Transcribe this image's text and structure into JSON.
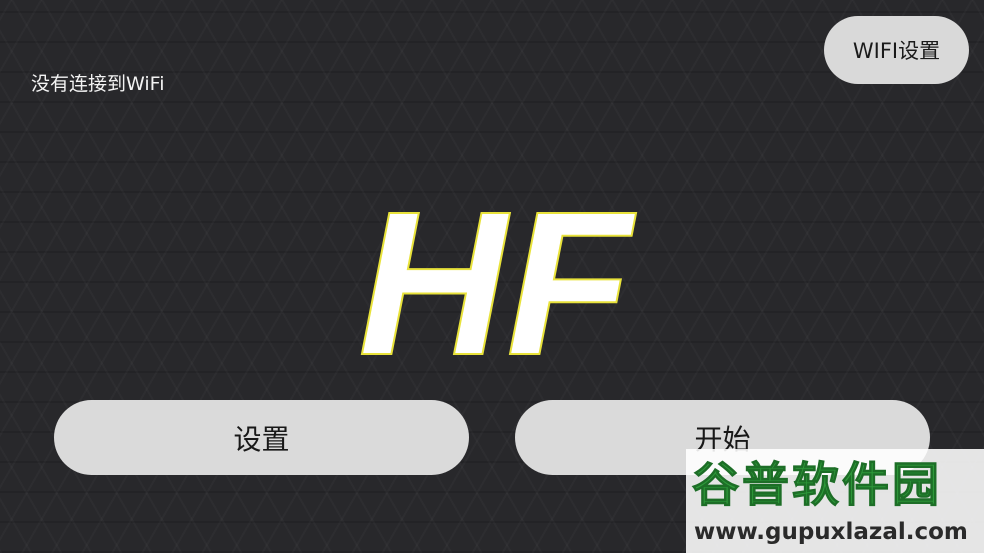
{
  "status": {
    "wifi_status_text": "没有连接到WiFi"
  },
  "header": {
    "wifi_settings_label": "WIFI设置"
  },
  "logo": {
    "text": "HF",
    "fill_color": "#ffffff",
    "outline_color": "#e8e23a"
  },
  "actions": {
    "settings_label": "设置",
    "start_label": "开始"
  },
  "watermark": {
    "title": "谷普软件园",
    "url": "www.gupuxlazal.com"
  },
  "colors": {
    "background": "#28282b",
    "button": "#dadada",
    "watermark_green": "#2e9a3a"
  }
}
